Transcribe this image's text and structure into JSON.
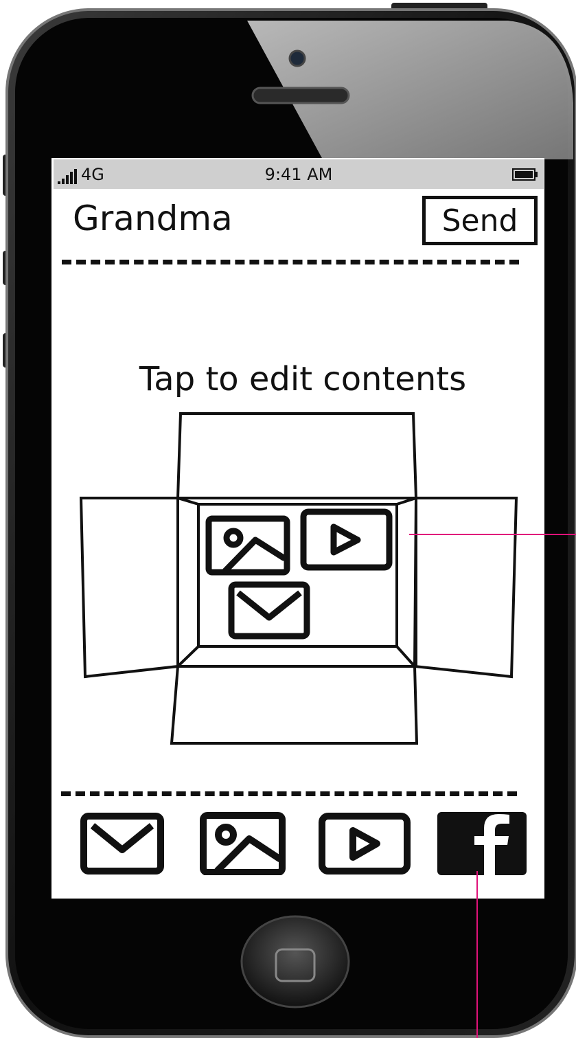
{
  "status_bar": {
    "network": "4G",
    "time": "9:41 AM"
  },
  "header": {
    "title": "Grandma",
    "send_label": "Send"
  },
  "content": {
    "hint": "Tap to edit contents"
  },
  "toolbar": {
    "items": [
      "mail-icon",
      "image-icon",
      "video-icon",
      "facebook-icon"
    ]
  },
  "colors": {
    "annotation": "#e0127a",
    "ink": "#111111",
    "status_bar": "#cfcfcf"
  }
}
